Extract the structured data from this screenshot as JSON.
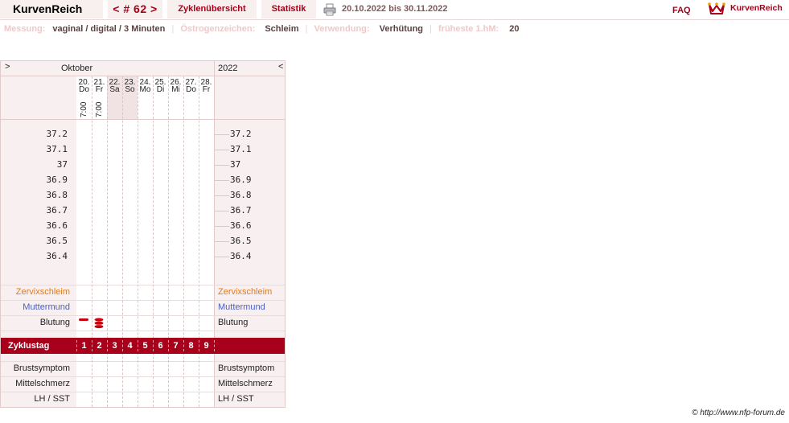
{
  "topbar": {
    "app_title": "KurvenReich",
    "cycle_nav": "< # 62 >",
    "cycle_overview": "Zyklenübersicht",
    "statistics": "Statistik",
    "print_icon": "printer-icon",
    "date_range": "20.10.2022 bis 30.11.2022",
    "faq": "FAQ",
    "logo_icon": "crown-icon",
    "logo_text": "KurvenReich"
  },
  "info": {
    "messung_label": "Messung:",
    "messung_value": "vaginal / digital / 3 Minuten",
    "oestrogen_label": "Östrogenzeichen:",
    "oestrogen_value": "Schleim",
    "verwendung_label": "Verwendung:",
    "verwendung_value": "Verhütung",
    "hm_label": "früheste 1.hM:",
    "hm_value": "20"
  },
  "chart": {
    "nav_left": ">",
    "month": "Oktober",
    "year": "2022",
    "nav_right": "<",
    "days": [
      {
        "date": "20.",
        "weekday": "Do",
        "time": "7:00"
      },
      {
        "date": "21.",
        "weekday": "Fr",
        "time": "7:00"
      },
      {
        "date": "22.",
        "weekday": "Sa",
        "time": ""
      },
      {
        "date": "23.",
        "weekday": "So",
        "time": ""
      },
      {
        "date": "24.",
        "weekday": "Mo",
        "time": ""
      },
      {
        "date": "25.",
        "weekday": "Di",
        "time": ""
      },
      {
        "date": "26.",
        "weekday": "Mi",
        "time": ""
      },
      {
        "date": "27.",
        "weekday": "Do",
        "time": ""
      },
      {
        "date": "28.",
        "weekday": "Fr",
        "time": ""
      }
    ],
    "temperatures": [
      "37.2",
      "37.1",
      "37",
      "36.9",
      "36.8",
      "36.7",
      "36.6",
      "36.5",
      "36.4"
    ],
    "rows": {
      "zervix": "Zervixschleim",
      "muttermund": "Muttermund",
      "blutung": "Blutung",
      "zyklustag": "Zyklustag",
      "brust": "Brustsymptom",
      "mittelschmerz": "Mittelschmerz",
      "lh": "LH / SST"
    },
    "bleeding": [
      "light",
      "heavy",
      "",
      "",
      "",
      "",
      "",
      "",
      ""
    ],
    "cycle_days": [
      "1",
      "2",
      "3",
      "4",
      "5",
      "6",
      "7",
      "8",
      "9"
    ],
    "colors": {
      "zervix": "#e07a1e",
      "muttermund": "#4a5fc0",
      "accent": "#a8001a"
    }
  },
  "footer": {
    "copyright": "© http://www.nfp-forum.de"
  }
}
